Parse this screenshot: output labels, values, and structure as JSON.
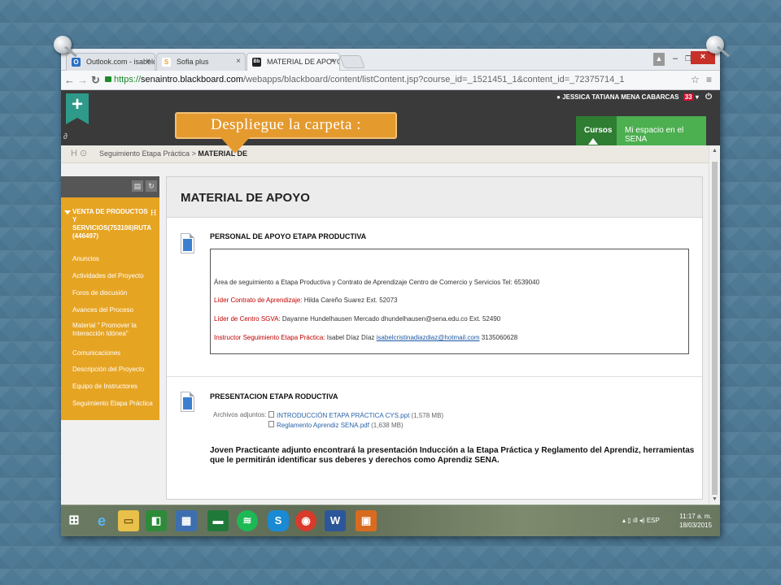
{
  "browser": {
    "tabs": [
      {
        "label": "Outlook.com - isabelcristi",
        "icon_color": "#2a70c7",
        "icon_text": "O"
      },
      {
        "label": "Sofia plus",
        "icon_color": "#e6a423",
        "icon_text": "S"
      },
      {
        "label": "MATERIAL DE APOYO – W",
        "icon_color": "#222222",
        "icon_text": "Bb"
      }
    ],
    "url_secure": "https://",
    "url_host": "senaintro.blackboard.com",
    "url_path": "/webapps/blackboard/content/listContent.jsp?course_id=_1521451_1&content_id=_72375714_1"
  },
  "header": {
    "user_name": "JESSICA TATIANA MENA CABARCAS",
    "notification_count": "33",
    "nav_cursos": "Cursos",
    "nav_espacio": "Mi espacio en el SENA"
  },
  "callout": {
    "text": "Despliegue la carpeta :",
    "color": "#e59a2e"
  },
  "breadcrumb": {
    "parent": "Seguimiento Etapa Práctica",
    "separator": ">",
    "current": "MATERIAL DE"
  },
  "sidebar": {
    "course_title": "VENTA DE PRODUCTOS Y SERVICIOS(753106)RUTA (446497)",
    "course_h": "H",
    "items": [
      {
        "label": "Anuncios"
      },
      {
        "label": "Actividades del Proyecto"
      },
      {
        "label": "Foros de discusión"
      },
      {
        "label": "Avances del Proceso"
      },
      {
        "label": "Material \" Promover la Interacción Idónea\""
      },
      {
        "label": "Comunicaciones"
      },
      {
        "label": "Descripción del Proyecto"
      },
      {
        "label": "Equipo de Instructores"
      },
      {
        "label": "Seguimiento Etapa Práctica"
      }
    ],
    "accent": "#e6a423"
  },
  "content": {
    "title": "MATERIAL DE APOYO",
    "item1": {
      "title": "PERSONAL DE APOYO ETAPA PRODUCTIVA",
      "line1": "Área de seguimiento a Etapa Productiva y Contrato de Aprendizaje Centro de Comercio y Servicios Tel: 6539040",
      "line2_label": "Líder Contrato de Aprendizaje:",
      "line2_value": " Hilda Careño Suarez  Ext. 52073",
      "line3_label": "Líder de Centro SGVA:",
      "line3_value": " Dayanne Hundelhausen Mercado  dhundelhausen@sena.edu.co Ext. 52490",
      "line4_label": "Instructor Seguimiento Etapa Práctica:",
      "line4_value": "  Isabel Díaz Díaz  ",
      "line4_link": "isabelcristinadiazdiaz@hotmail.com",
      "line4_phone": " 3135060628"
    },
    "item2": {
      "title": "PRESENTACION ETAPA RODUCTIVA",
      "attach_label": "Archivos adjuntos:",
      "attachments": [
        {
          "name": "INTRODUCCIÓN ETAPA PRÁCTICA CYS.ppt",
          "size": " (1,578 MB)"
        },
        {
          "name": "Reglamento Aprendiz SENA.pdf",
          "size": " (1,638 MB)"
        }
      ],
      "message": "Joven Practicante adjunto encontrará la presentación Inducción a la Etapa Práctica y Reglamento del Aprendiz, herramientas que le permitirán identificar sus deberes y derechos como Aprendiz SENA."
    }
  },
  "taskbar": {
    "tray_lang": "ESP",
    "time": "11:17 a. m.",
    "date": "18/03/2015"
  }
}
